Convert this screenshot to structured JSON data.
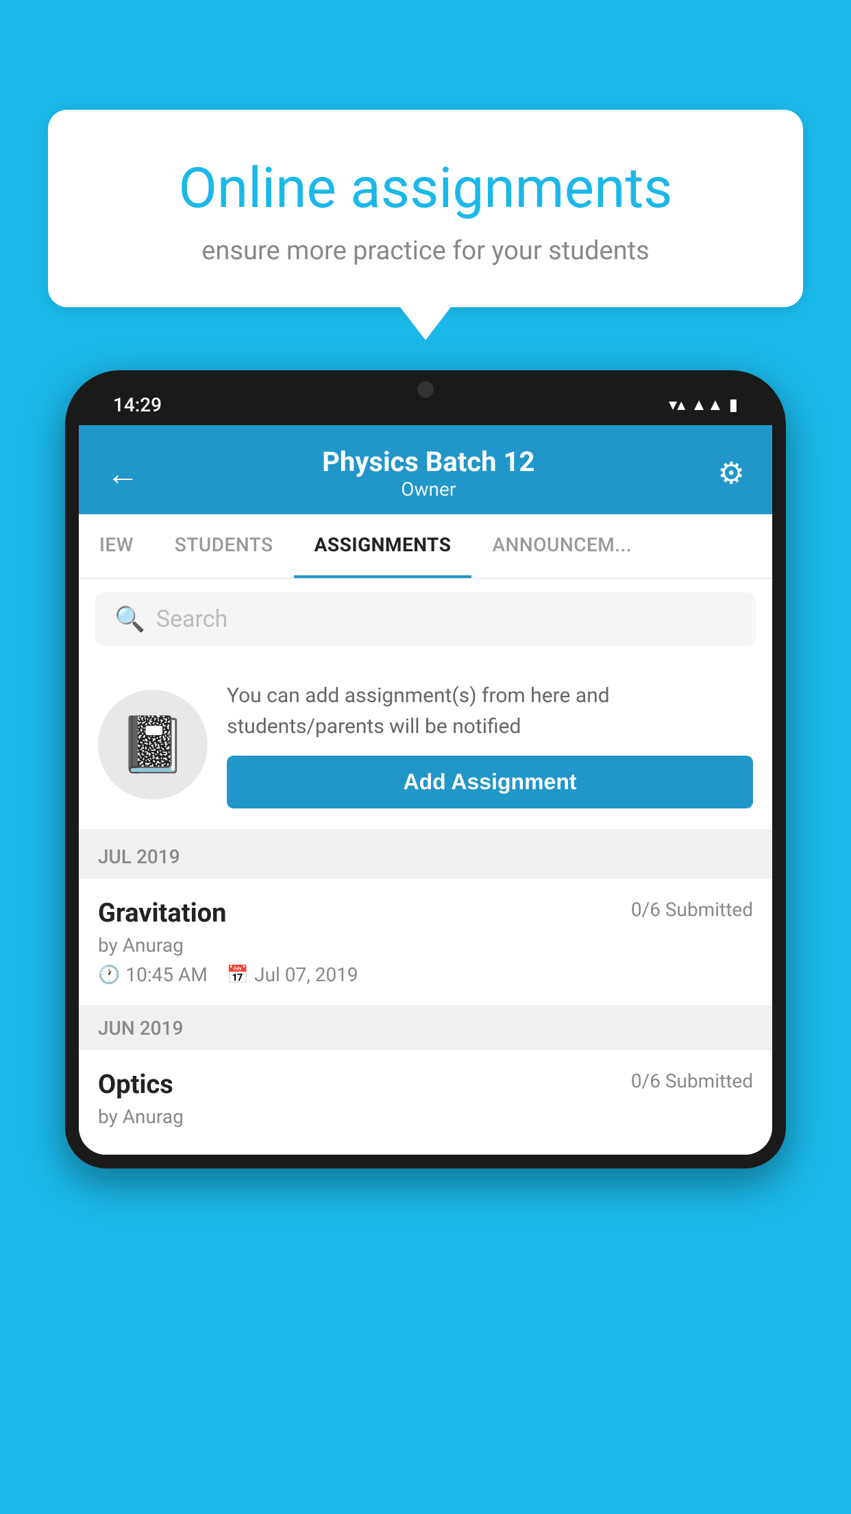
{
  "background_color": "#1ab8e8",
  "speech_bubble": {
    "title": "Online assignments",
    "subtitle": "ensure more practice for your students"
  },
  "phone": {
    "status_bar": {
      "time": "14:29"
    },
    "header": {
      "title": "Physics Batch 12",
      "subtitle": "Owner",
      "back_icon": "←",
      "gear_icon": "⚙"
    },
    "tabs": [
      {
        "label": "IEW",
        "active": false
      },
      {
        "label": "STUDENTS",
        "active": false
      },
      {
        "label": "ASSIGNMENTS",
        "active": true
      },
      {
        "label": "ANNOUNCEM...",
        "active": false
      }
    ],
    "search": {
      "placeholder": "Search"
    },
    "promo": {
      "text": "You can add assignment(s) from here and students/parents will be notified",
      "button_label": "Add Assignment"
    },
    "sections": [
      {
        "label": "JUL 2019",
        "assignments": [
          {
            "name": "Gravitation",
            "submitted": "0/6 Submitted",
            "by": "by Anurag",
            "time": "10:45 AM",
            "date": "Jul 07, 2019"
          }
        ]
      },
      {
        "label": "JUN 2019",
        "assignments": [
          {
            "name": "Optics",
            "submitted": "0/6 Submitted",
            "by": "by Anurag",
            "time": "",
            "date": ""
          }
        ]
      }
    ]
  }
}
